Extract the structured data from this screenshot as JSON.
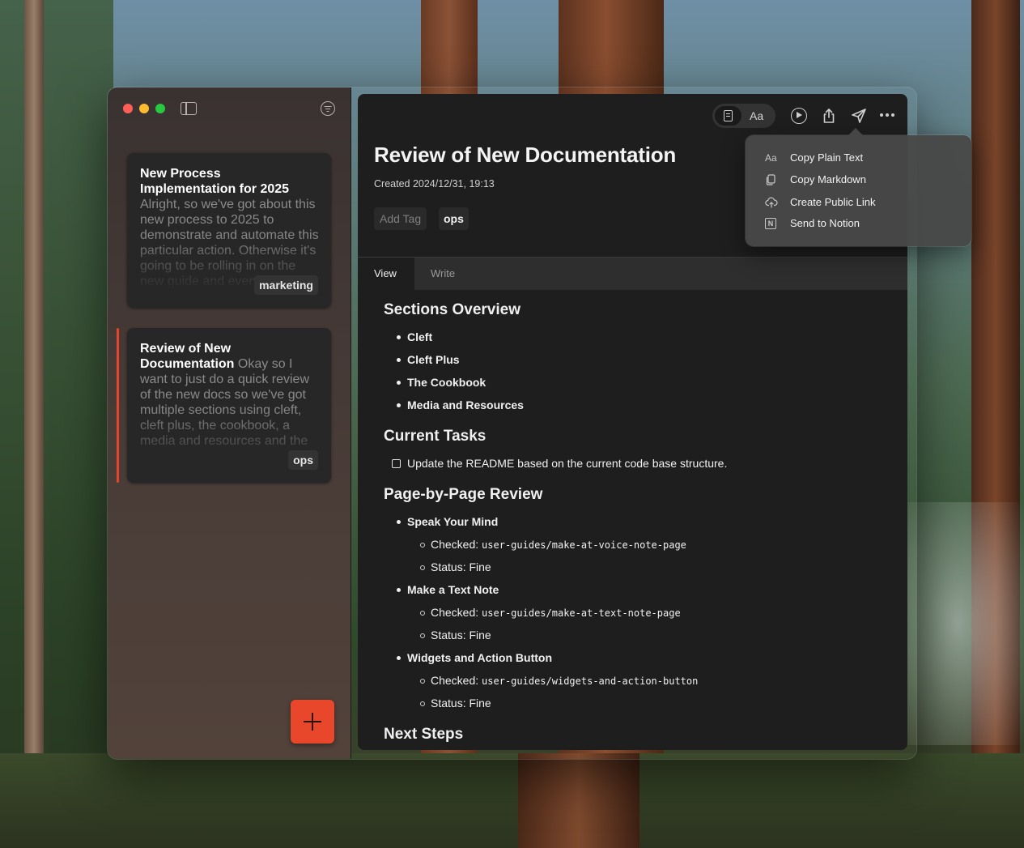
{
  "sidebar": {
    "notes": [
      {
        "title": "New Process Implementation for 2025",
        "preview": "Alright, so we've got about this new process to 2025 to demonstrate and automate this particular action. Otherwise it's going to be rolling in on the new guide and everything in the",
        "tag": "marketing"
      },
      {
        "title": "Review of New Documentation",
        "preview": "Okay so I want to just do a quick review of the new docs so we've got multiple sections using cleft, cleft plus, the cookbook, a media and resources and the",
        "tag": "ops"
      }
    ],
    "selected_index": 1
  },
  "toolbar": {
    "font_toggle_label": "Aa"
  },
  "document": {
    "title": "Review of New Documentation",
    "created": "Created 2024/12/31, 19:13",
    "add_tag_label": "Add Tag",
    "tags": [
      "ops"
    ],
    "tabs": [
      {
        "label": "View",
        "active": true
      },
      {
        "label": "Write",
        "active": false
      }
    ],
    "sections": {
      "overview": {
        "heading": "Sections Overview",
        "items": [
          "Cleft",
          "Cleft Plus",
          "The Cookbook",
          "Media and Resources"
        ]
      },
      "tasks": {
        "heading": "Current Tasks",
        "items": [
          "Update the README based on the current code base structure."
        ]
      },
      "review": {
        "heading": "Page-by-Page Review",
        "pages": [
          {
            "name": "Speak Your Mind",
            "checked_label": "Checked:",
            "path": "user-guides/make-at-voice-note-page",
            "status": "Status: Fine"
          },
          {
            "name": "Make a Text Note",
            "checked_label": "Checked:",
            "path": "user-guides/make-at-text-note-page",
            "status": "Status: Fine"
          },
          {
            "name": "Widgets and Action Button",
            "checked_label": "Checked:",
            "path": "user-guides/widgets-and-action-button",
            "status": "Status: Fine"
          }
        ]
      },
      "next": {
        "heading": "Next Steps"
      }
    }
  },
  "share_menu": {
    "items": [
      {
        "icon": "text-format-icon",
        "glyph": "Aa",
        "label": "Copy Plain Text"
      },
      {
        "icon": "copy-document-icon",
        "glyph": "",
        "label": "Copy Markdown"
      },
      {
        "icon": "cloud-link-icon",
        "glyph": "",
        "label": "Create Public Link"
      },
      {
        "icon": "notion-icon",
        "glyph": "N",
        "label": "Send to Notion"
      }
    ]
  },
  "colors": {
    "accent": "#e8472b",
    "panel": "#1e1e1e",
    "card": "#272727"
  }
}
